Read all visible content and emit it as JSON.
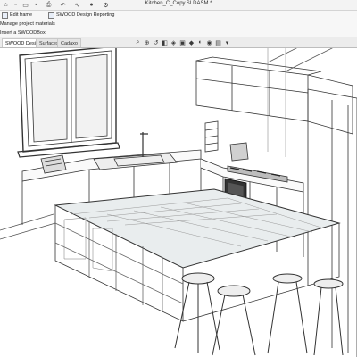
{
  "window": {
    "title": "Kitchen_C_Copy.SLDASM *"
  },
  "quick_access": {
    "icons": [
      "home-icon",
      "new-file-icon",
      "open-file-icon",
      "save-icon",
      "print-icon",
      "undo-icon",
      "select-icon",
      "rebuild-icon",
      "options-icon"
    ]
  },
  "commands": {
    "row1": [
      {
        "label": "Edit frame",
        "icon": "frame-icon"
      },
      {
        "label": "SWOOD Design Reporting",
        "icon": "report-icon"
      }
    ],
    "row2": [
      {
        "label": "Manage project materials",
        "icon": "materials-icon"
      }
    ],
    "row3": [
      {
        "label": "Insert a SWOODBox",
        "icon": "box-icon"
      }
    ]
  },
  "tabs": [
    {
      "label": "SWOOD Design",
      "active": true
    },
    {
      "label": "Surfaces",
      "active": false
    },
    {
      "label": "Cadaxo",
      "active": false
    }
  ],
  "view_toolbar": {
    "icons": [
      "zoom-to-fit-icon",
      "zoom-area-icon",
      "previous-view-icon",
      "section-view-icon",
      "dynamic-annotation-icon",
      "view-orientation-icon",
      "display-style-icon",
      "hide-show-icon",
      "edit-appearance-icon",
      "scene-icon",
      "view-settings-icon"
    ]
  },
  "viewport": {
    "content": "3D wireframe kitchen assembly",
    "line_color": "#333333",
    "glass_color": "#cfd6d8"
  }
}
